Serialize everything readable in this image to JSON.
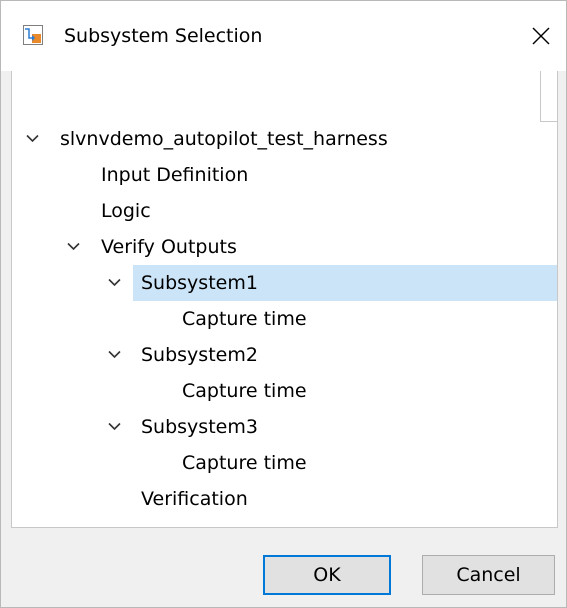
{
  "dialog": {
    "title": "Subsystem Selection",
    "icons": {
      "app": "simulink-model-icon",
      "close": "close-icon",
      "expand": "chevron-down-icon"
    },
    "colors": {
      "selection": "#cce4f7",
      "default_button_border": "#0078d7",
      "app_icon_orange": "#e8892b",
      "app_icon_blue": "#2b7cd3"
    }
  },
  "tree": {
    "root": "slvnvdemo_autopilot_test_harness",
    "input_definition": "Input Definition",
    "logic": "Logic",
    "verify_outputs": "Verify Outputs",
    "subsystem1": "Subsystem1",
    "subsystem1_child": "Capture time",
    "subsystem2": "Subsystem2",
    "subsystem2_child": "Capture time",
    "subsystem3": "Subsystem3",
    "subsystem3_child": "Capture time",
    "verification": "Verification",
    "selected": "Subsystem1"
  },
  "buttons": {
    "ok": "OK",
    "cancel": "Cancel"
  }
}
